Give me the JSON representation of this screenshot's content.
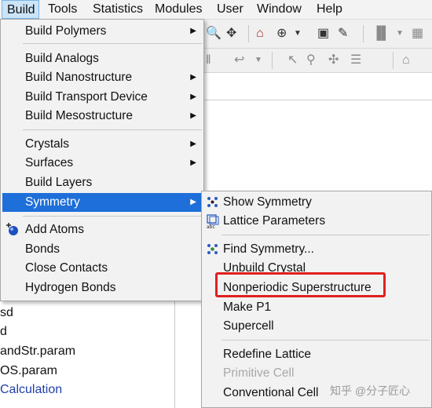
{
  "menubar": {
    "items": [
      "Build",
      "Tools",
      "Statistics",
      "Modules",
      "User",
      "Window",
      "Help"
    ],
    "active": "Build"
  },
  "build_menu": {
    "items": [
      {
        "label": "Build Polymers",
        "submenu": true
      },
      {
        "label": "Build Analogs",
        "submenu": false
      },
      {
        "label": "Build Nanostructure",
        "submenu": true
      },
      {
        "label": "Build Transport Device",
        "submenu": true
      },
      {
        "label": "Build Mesostructure",
        "submenu": true
      },
      {
        "label": "Crystals",
        "submenu": true
      },
      {
        "label": "Surfaces",
        "submenu": true
      },
      {
        "label": "Build Layers",
        "submenu": false
      },
      {
        "label": "Symmetry",
        "submenu": true,
        "highlighted": true
      },
      {
        "label": "Add Atoms",
        "submenu": false,
        "icon": "add-atom-icon"
      },
      {
        "label": "Bonds",
        "submenu": false
      },
      {
        "label": "Close Contacts",
        "submenu": false
      },
      {
        "label": "Hydrogen Bonds",
        "submenu": false
      }
    ]
  },
  "symmetry_menu": {
    "items": [
      {
        "label": "Show Symmetry",
        "icon": "symmetry-dots-icon",
        "disabled": false
      },
      {
        "label": "Lattice Parameters",
        "icon": "lattice-abc-icon",
        "disabled": false
      },
      {
        "label": "Find Symmetry...",
        "icon": "find-symmetry-icon",
        "disabled": false
      },
      {
        "label": "Unbuild Crystal",
        "disabled": false
      },
      {
        "label": "Nonperiodic Superstructure",
        "disabled": false,
        "annotated": true
      },
      {
        "label": "Make P1",
        "disabled": false
      },
      {
        "label": "Supercell",
        "disabled": false
      },
      {
        "label": "Redefine Lattice",
        "disabled": false
      },
      {
        "label": "Primitive Cell",
        "disabled": true
      },
      {
        "label": "Conventional Cell",
        "disabled": false
      }
    ]
  },
  "file_list": [
    "sd",
    "d",
    "andStr.param",
    "OS.param",
    "Calculation"
  ],
  "watermark": "知乎 @分子匠心",
  "colors": {
    "highlight": "#1e6fd9",
    "annotation": "#e02020",
    "menu_bg": "#f2f2f2"
  }
}
